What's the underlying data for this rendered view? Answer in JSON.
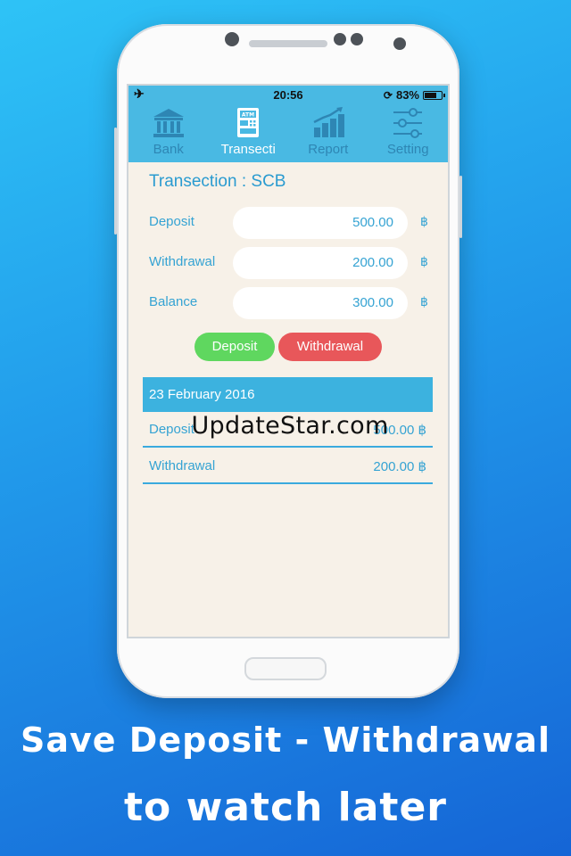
{
  "status_bar": {
    "time": "20:56",
    "battery": "83%",
    "battery_level": 0.83
  },
  "tabs": [
    {
      "label": "Bank",
      "icon": "bank-icon",
      "active": false
    },
    {
      "label": "Transecti",
      "icon": "atm-icon",
      "active": true
    },
    {
      "label": "Report",
      "icon": "bar-chart-icon",
      "active": false
    },
    {
      "label": "Setting",
      "icon": "sliders-icon",
      "active": false
    }
  ],
  "page": {
    "title": "Transection : SCB"
  },
  "summary": {
    "currency": "฿",
    "deposit": {
      "label": "Deposit",
      "value": "500.00"
    },
    "withdrawal": {
      "label": "Withdrawal",
      "value": "200.00"
    },
    "balance": {
      "label": "Balance",
      "value": "300.00"
    }
  },
  "actions": {
    "deposit_label": "Deposit",
    "withdrawal_label": "Withdrawal"
  },
  "history": {
    "date": "23 February 2016",
    "items": [
      {
        "type": "Deposit",
        "amount": "500.00 ฿"
      },
      {
        "type": "Withdrawal",
        "amount": "200.00 ฿"
      }
    ]
  },
  "watermark": "UpdateStar.com",
  "caption": {
    "line1": "Save Deposit - Withdrawal",
    "line2": "to watch later"
  },
  "colors": {
    "accent": "#49b9e3",
    "deposit": "#5fd75f",
    "withdrawal": "#e8575a",
    "text": "#35a3d3"
  }
}
